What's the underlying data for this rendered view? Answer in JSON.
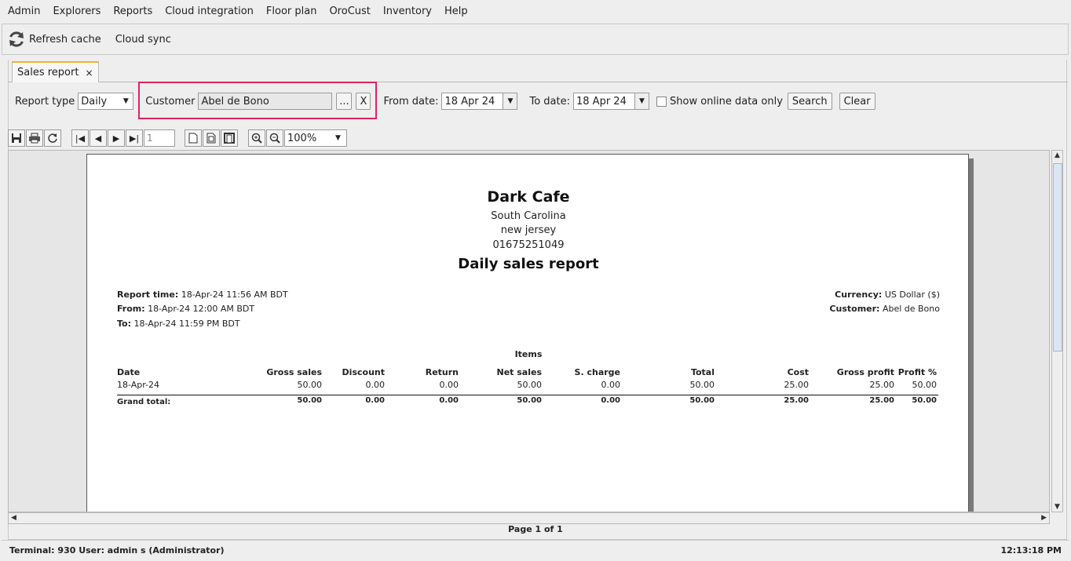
{
  "menu": [
    "Admin",
    "Explorers",
    "Reports",
    "Cloud integration",
    "Floor plan",
    "OroCust",
    "Inventory",
    "Help"
  ],
  "toolbar": {
    "refresh_label": "Refresh cache",
    "cloud_sync_label": "Cloud sync"
  },
  "tab": {
    "label": "Sales report",
    "close": "×"
  },
  "filters": {
    "report_type_label": "Report type",
    "report_type_value": "Daily",
    "customer_label": "Customer",
    "customer_value": "Abel de Bono",
    "browse_label": "...",
    "clear_customer_label": "X",
    "from_label": "From date:",
    "from_value": "18 Apr 24",
    "to_label": "To date:",
    "to_value": "18 Apr 24",
    "online_only_label": "Show online data only",
    "search_label": "Search",
    "clear_label": "Clear"
  },
  "viewer": {
    "page_value": "1",
    "zoom_value": "100%",
    "page_indicator": "Page 1 of 1"
  },
  "report": {
    "company": "Dark Cafe",
    "address1": "South Carolina",
    "address2": "new jersey",
    "phone": "01675251049",
    "title": "Daily sales report",
    "report_time_label": "Report time:",
    "report_time": "18-Apr-24 11:56 AM BDT",
    "from_label": "From:",
    "from": "18-Apr-24 12:00 AM BDT",
    "to_label": "To:",
    "to": "18-Apr-24 11:59 PM BDT",
    "currency_label": "Currency:",
    "currency": "US Dollar ($)",
    "customer_label": "Customer:",
    "customer": "Abel de Bono",
    "section": "Items",
    "columns": [
      "Date",
      "Gross sales",
      "Discount",
      "Return",
      "Net sales",
      "S. charge",
      "Total",
      "Cost",
      "Gross profit",
      "Profit %"
    ],
    "row": [
      "18-Apr-24",
      "50.00",
      "0.00",
      "0.00",
      "50.00",
      "0.00",
      "50.00",
      "25.00",
      "25.00",
      "50.00"
    ],
    "grand_total_label": "Grand total:",
    "totals": [
      "50.00",
      "0.00",
      "0.00",
      "50.00",
      "0.00",
      "50.00",
      "25.00",
      "25.00",
      "50.00"
    ]
  },
  "status": {
    "left": "Terminal: 930 User: admin s (Administrator)",
    "time": "12:13:18 PM"
  }
}
